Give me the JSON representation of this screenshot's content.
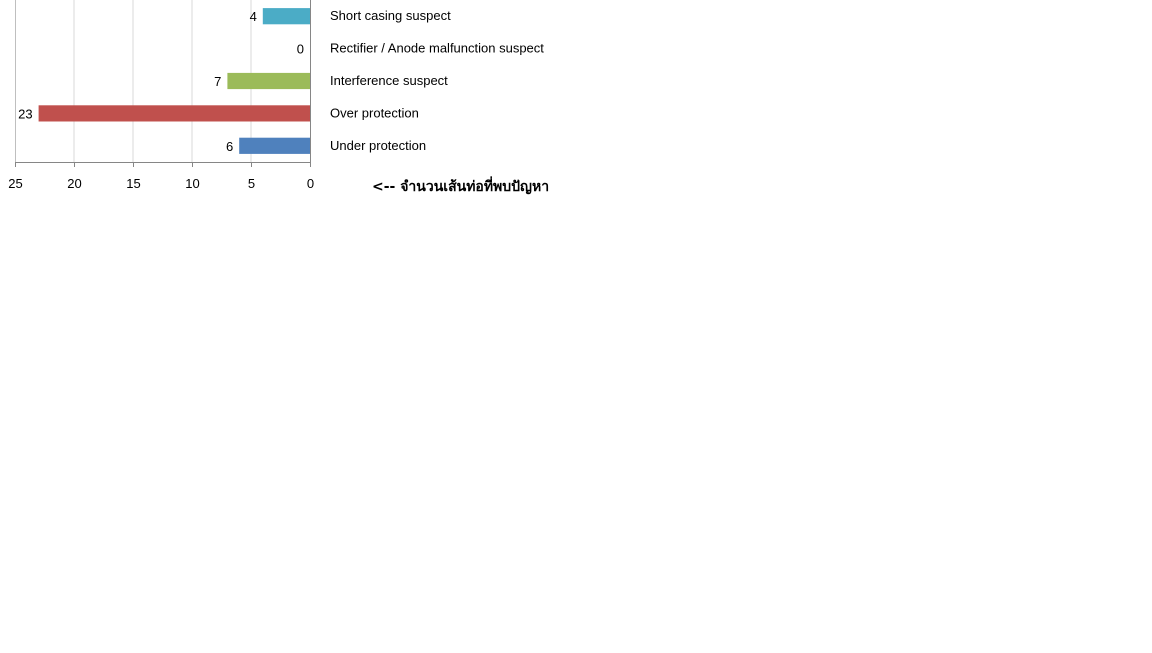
{
  "chart_data": {
    "type": "bar",
    "orientation": "horizontal",
    "x_direction": "reversed",
    "categories": [
      "Short casing suspect",
      "Rectifier / Anode malfunction suspect",
      "Interference suspect",
      "Over protection",
      "Under protection"
    ],
    "values": [
      4,
      0,
      7,
      23,
      6
    ],
    "bar_colors": [
      "#4bacc6",
      "#8064a2",
      "#9bbb59",
      "#c0504d",
      "#4f81bd"
    ],
    "data_labels": [
      "4",
      "0",
      "7",
      "23",
      "6"
    ],
    "xlim": [
      0,
      25
    ],
    "x_ticks": [
      "25",
      "20",
      "15",
      "10",
      "5",
      "0"
    ],
    "x_tick_values": [
      25,
      20,
      15,
      10,
      5,
      0
    ],
    "grid": "vertical",
    "axis_note": "<-- จำนวนเส้นท่อที่พบปัญหา",
    "title": "",
    "xlabel": "",
    "ylabel": ""
  }
}
